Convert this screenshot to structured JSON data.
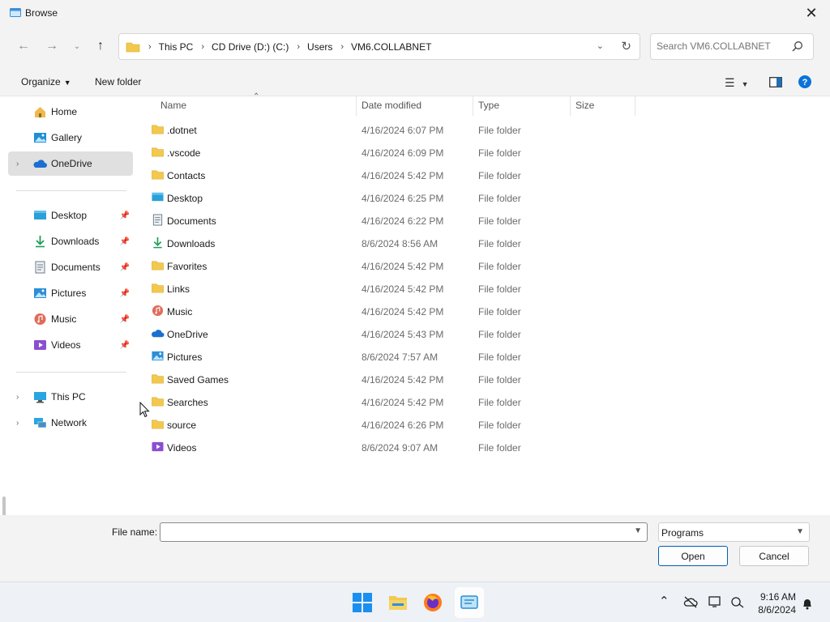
{
  "window": {
    "title": "Browse"
  },
  "breadcrumbs": [
    {
      "label": "This PC"
    },
    {
      "label": "CD Drive (D:) (C:)"
    },
    {
      "label": "Users"
    },
    {
      "label": "VM6.COLLABNET"
    }
  ],
  "search": {
    "placeholder": "Search VM6.COLLABNET"
  },
  "toolbar": {
    "organize_label": "Organize",
    "new_folder_label": "New folder"
  },
  "nav": {
    "top": [
      {
        "label": "Home",
        "icon": "home-icon"
      },
      {
        "label": "Gallery",
        "icon": "gallery-icon"
      },
      {
        "label": "OneDrive",
        "icon": "onedrive-icon",
        "selected": true
      }
    ],
    "quick": [
      {
        "label": "Desktop",
        "icon": "desktop-icon"
      },
      {
        "label": "Downloads",
        "icon": "downloads-icon"
      },
      {
        "label": "Documents",
        "icon": "documents-icon"
      },
      {
        "label": "Pictures",
        "icon": "pictures-icon"
      },
      {
        "label": "Music",
        "icon": "music-icon"
      },
      {
        "label": "Videos",
        "icon": "videos-icon"
      }
    ],
    "bottom": [
      {
        "label": "This PC",
        "icon": "this-pc-icon"
      },
      {
        "label": "Network",
        "icon": "network-icon"
      }
    ]
  },
  "columns": {
    "name": "Name",
    "date": "Date modified",
    "type": "Type",
    "size": "Size"
  },
  "files": [
    {
      "name": ".dotnet",
      "date": "4/16/2024 6:07 PM",
      "type": "File folder",
      "icon": "folder-icon"
    },
    {
      "name": ".vscode",
      "date": "4/16/2024 6:09 PM",
      "type": "File folder",
      "icon": "folder-icon"
    },
    {
      "name": "Contacts",
      "date": "4/16/2024 5:42 PM",
      "type": "File folder",
      "icon": "folder-icon"
    },
    {
      "name": "Desktop",
      "date": "4/16/2024 6:25 PM",
      "type": "File folder",
      "icon": "desktop-icon"
    },
    {
      "name": "Documents",
      "date": "4/16/2024 6:22 PM",
      "type": "File folder",
      "icon": "documents-icon"
    },
    {
      "name": "Downloads",
      "date": "8/6/2024 8:56 AM",
      "type": "File folder",
      "icon": "downloads-icon"
    },
    {
      "name": "Favorites",
      "date": "4/16/2024 5:42 PM",
      "type": "File folder",
      "icon": "folder-icon"
    },
    {
      "name": "Links",
      "date": "4/16/2024 5:42 PM",
      "type": "File folder",
      "icon": "folder-icon"
    },
    {
      "name": "Music",
      "date": "4/16/2024 5:42 PM",
      "type": "File folder",
      "icon": "music-icon"
    },
    {
      "name": "OneDrive",
      "date": "4/16/2024 5:43 PM",
      "type": "File folder",
      "icon": "onedrive-icon"
    },
    {
      "name": "Pictures",
      "date": "8/6/2024 7:57 AM",
      "type": "File folder",
      "icon": "pictures-icon"
    },
    {
      "name": "Saved Games",
      "date": "4/16/2024 5:42 PM",
      "type": "File folder",
      "icon": "folder-icon"
    },
    {
      "name": "Searches",
      "date": "4/16/2024 5:42 PM",
      "type": "File folder",
      "icon": "folder-icon"
    },
    {
      "name": "source",
      "date": "4/16/2024 6:26 PM",
      "type": "File folder",
      "icon": "folder-icon"
    },
    {
      "name": "Videos",
      "date": "8/6/2024 9:07 AM",
      "type": "File folder",
      "icon": "videos-icon"
    }
  ],
  "bottom": {
    "file_name_label": "File name:",
    "file_name_value": "",
    "file_type": "Programs",
    "open_label": "Open",
    "cancel_label": "Cancel"
  },
  "clock": {
    "time": "9:16 AM",
    "date": "8/6/2024"
  },
  "colors": {
    "accent": "#005fb8",
    "folder": "#f2c94c",
    "help": "#0a74da"
  }
}
